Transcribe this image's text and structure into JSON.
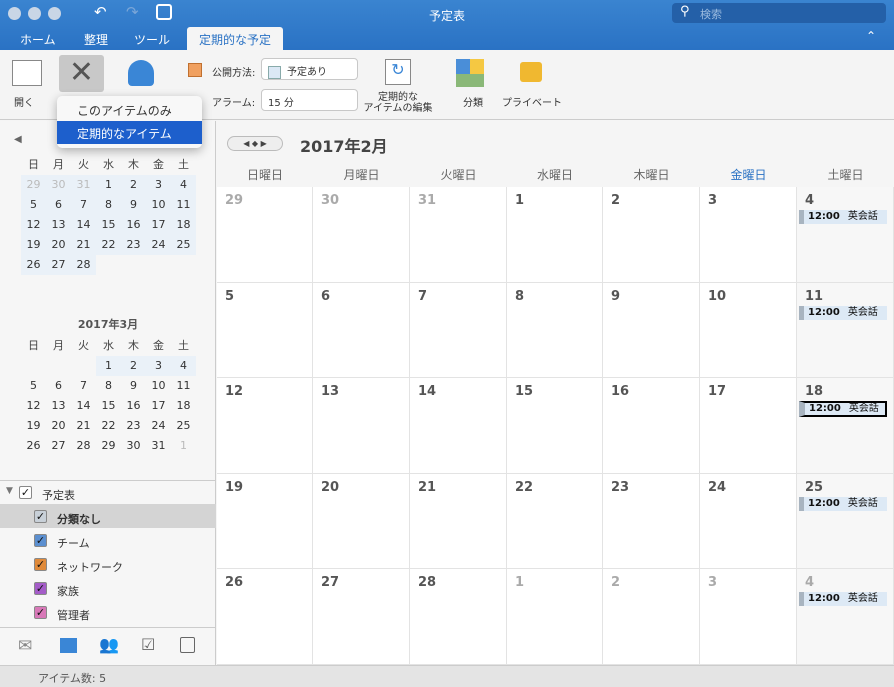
{
  "window": {
    "title": "予定表",
    "search_placeholder": "検索"
  },
  "tabs": [
    {
      "label": "ホーム"
    },
    {
      "label": "整理"
    },
    {
      "label": "ツール"
    },
    {
      "label": "定期的な予定"
    }
  ],
  "ribbon": {
    "open": "開く",
    "show_as_label": "公開方法:",
    "show_as_value": "予定あり",
    "alarm_label": "アラーム:",
    "alarm_value": "15 分",
    "edit_recurring_1": "定期的な",
    "edit_recurring_2": "アイテムの編集",
    "categorize": "分類",
    "private": "プライベート"
  },
  "dropdown": {
    "items": [
      {
        "label": "このアイテムのみ"
      },
      {
        "label": "定期的なアイテム"
      }
    ],
    "selected": 1
  },
  "minical": {
    "weekdays": [
      "日",
      "月",
      "火",
      "水",
      "木",
      "金",
      "土"
    ],
    "feb": {
      "days": [
        "29",
        "30",
        "31",
        "1",
        "2",
        "3",
        "4",
        "5",
        "6",
        "7",
        "8",
        "9",
        "10",
        "11",
        "12",
        "13",
        "14",
        "15",
        "16",
        "17",
        "18",
        "19",
        "20",
        "21",
        "22",
        "23",
        "24",
        "25",
        "26",
        "27",
        "28"
      ]
    },
    "mar": {
      "title": "2017年3月",
      "days": [
        "",
        "",
        "",
        "1",
        "2",
        "3",
        "4",
        "5",
        "6",
        "7",
        "8",
        "9",
        "10",
        "11",
        "12",
        "13",
        "14",
        "15",
        "16",
        "17",
        "18",
        "19",
        "20",
        "21",
        "22",
        "23",
        "24",
        "25",
        "26",
        "27",
        "28",
        "29",
        "30",
        "31",
        "1"
      ]
    }
  },
  "calendars": {
    "group": "予定表",
    "items": [
      {
        "label": "分類なし",
        "color": "#c8d0d8",
        "selected": true
      },
      {
        "label": "チーム",
        "color": "#5b8fd0"
      },
      {
        "label": "ネットワーク",
        "color": "#e08a3a"
      },
      {
        "label": "家族",
        "color": "#a45cc8"
      },
      {
        "label": "管理者",
        "color": "#d878b8"
      }
    ]
  },
  "main": {
    "month_title": "2017年2月",
    "weekdays": [
      "日曜日",
      "月曜日",
      "火曜日",
      "水曜日",
      "木曜日",
      "金曜日",
      "土曜日"
    ],
    "today_col": 5,
    "weeks": [
      [
        "29",
        "30",
        "31",
        "1",
        "2",
        "3",
        "4"
      ],
      [
        "5",
        "6",
        "7",
        "8",
        "9",
        "10",
        "11"
      ],
      [
        "12",
        "13",
        "14",
        "15",
        "16",
        "17",
        "18"
      ],
      [
        "19",
        "20",
        "21",
        "22",
        "23",
        "24",
        "25"
      ],
      [
        "26",
        "27",
        "28",
        "1",
        "2",
        "3",
        "4"
      ]
    ],
    "events": [
      {
        "week": 0,
        "time": "12:00",
        "title": "英会話"
      },
      {
        "week": 1,
        "time": "12:00",
        "title": "英会話"
      },
      {
        "week": 2,
        "time": "12:00",
        "title": "英会話",
        "selected": true
      },
      {
        "week": 3,
        "time": "12:00",
        "title": "英会話"
      },
      {
        "week": 4,
        "time": "12:00",
        "title": "英会話"
      }
    ]
  },
  "status": {
    "text": "アイテム数: 5"
  },
  "colors": {
    "accent": "#2a72c4",
    "selection": "#1d5fcc"
  }
}
